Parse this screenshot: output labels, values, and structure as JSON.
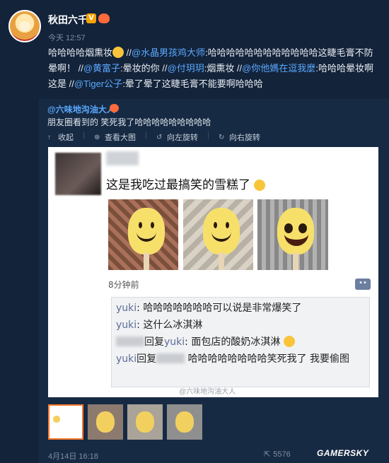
{
  "author": {
    "name": "秋田六千",
    "time": "今天 12:57"
  },
  "post": {
    "text_start": "哈哈哈哈烟熏妆",
    "sep1": " //",
    "m1": "@水晶男孩鸡大师",
    "t1": ":哈哈哈哈哈哈哈哈哈哈哈哈这睫毛膏不防晕啊！ //",
    "m2": "@黄富子",
    "t2": ":晕妆的你 //",
    "m3": "@付玥玥",
    "t3": ":烟熏妆 //",
    "m4": "@你他媽在逗我麼",
    "t4": ":哈哈哈晕妆啊这是 //",
    "m5": "@Tiger公子",
    "t5": ":晕了晕了这睫毛膏不能要啊哈哈哈"
  },
  "repost": {
    "author": "@六味地沟油大人",
    "text": "朋友圈看到的 笑死我了哈哈哈哈哈哈哈哈哈",
    "toolbar": {
      "collapse": "收起",
      "view_large": "查看大图",
      "rotate_left": "向左旋转",
      "rotate_right": "向右旋转"
    }
  },
  "image": {
    "caption": "这是我吃过最搞笑的雪糕了",
    "time_ago": "8分钟前",
    "more": "••",
    "comments": [
      {
        "name": "yuki",
        "text": ": 哈哈哈哈哈哈哈可以说是非常爆笑了"
      },
      {
        "name": "yuki",
        "text": ": 这什么冰淇淋"
      },
      {
        "reply_word": "回复",
        "name": "yuki",
        "text": ": 面包店的酸奶冰淇淋"
      },
      {
        "name": "yuki",
        "reply_word": "回复",
        "text": "哈哈哈哈哈哈哈哈笑死我了 我要偷图"
      }
    ],
    "watermark": "@六味地沟油大人"
  },
  "footer": {
    "date": "4月14日 16:18",
    "shares": "5576",
    "brand": "GAMERSKY"
  }
}
